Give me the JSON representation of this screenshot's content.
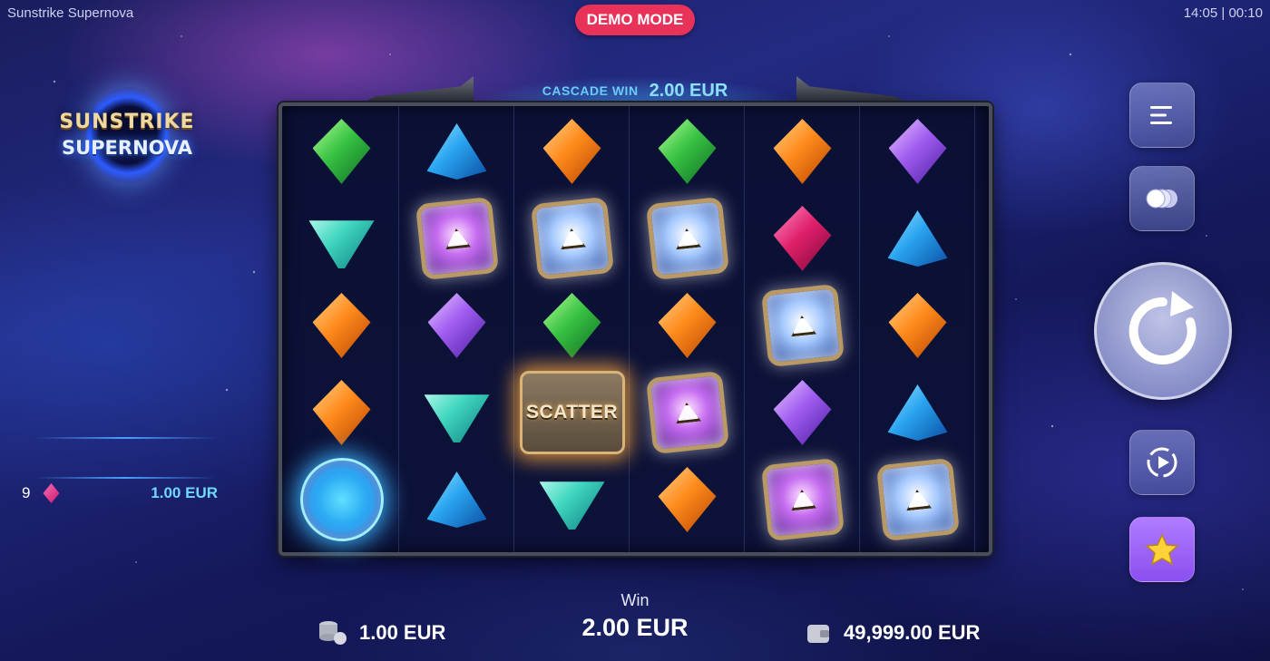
{
  "app": {
    "title": "Sunstrike Supernova",
    "clock": "14:05 | 00:10",
    "demo_badge": "DEMO MODE"
  },
  "logo": {
    "line1": "SUNSTRIKE",
    "line2": "SUPERNOVA"
  },
  "paytable": {
    "count": "9",
    "symbol_icon": "pink-gem-icon",
    "value": "1.00 EUR"
  },
  "cascade": {
    "label": "CASCADE WIN",
    "value": "2.00 EUR"
  },
  "reels": [
    [
      "green-gem",
      "teal-gem",
      "orange-gem",
      "orange-gem",
      "portal-wild"
    ],
    [
      "blue-gem",
      "purple-cube",
      "purple-gem",
      "teal-gem",
      "blue-gem"
    ],
    [
      "orange-gem",
      "ice-cube",
      "green-gem",
      "scatter",
      "teal-gem"
    ],
    [
      "green-gem",
      "ice-cube",
      "orange-gem",
      "purple-cube",
      "orange-gem"
    ],
    [
      "orange-gem",
      "pink-gem",
      "ice-cube",
      "purple-gem",
      "purple-cube"
    ],
    [
      "purple-gem",
      "blue-gem",
      "orange-gem",
      "blue-gem",
      "ice-cube"
    ]
  ],
  "scatter_label": "SCATTER",
  "controls": {
    "menu_icon": "menu-icon",
    "bet_icon": "coins-toggle-icon",
    "spin_icon": "spin-arrow-icon",
    "autoplay_icon": "autoplay-icon",
    "favorites_icon": "star-icon"
  },
  "footer": {
    "bet_value": "1.00 EUR",
    "win_label": "Win",
    "win_value": "2.00 EUR",
    "balance_value": "49,999.00 EUR"
  },
  "colors": {
    "demo_badge": "#e8325a",
    "cascade_text": "#6fd0ff",
    "favorite_button": "#a066ff"
  }
}
